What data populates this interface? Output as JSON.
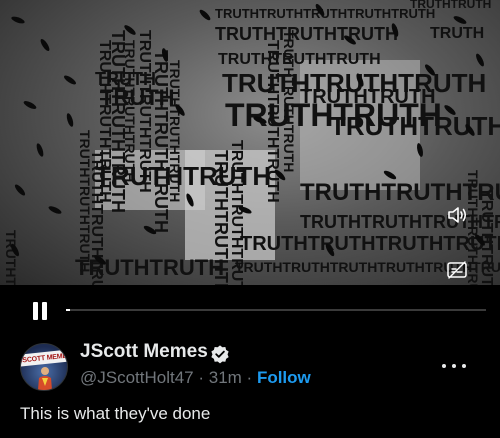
{
  "video": {
    "wall_word": "TRUTH",
    "progress_fraction": 0.01,
    "volume_icon": "speaker-volume-icon",
    "captions_icon": "captions-icon"
  },
  "player": {
    "pause_icon": "pause-icon"
  },
  "post": {
    "avatar_text": "JSCOTT MEMES",
    "author_name": "JScott Memes",
    "verified_icon": "verified-badge-icon",
    "handle": "@JScottHolt47",
    "separator": " · ",
    "time_ago": "31m",
    "follow_label": "Follow",
    "more_icon": "more-options-icon",
    "text": "This is what they've done"
  },
  "colors": {
    "background": "#000000",
    "text_primary": "#e7e9ea",
    "text_secondary": "#71767b",
    "accent": "#1d9bf0"
  }
}
